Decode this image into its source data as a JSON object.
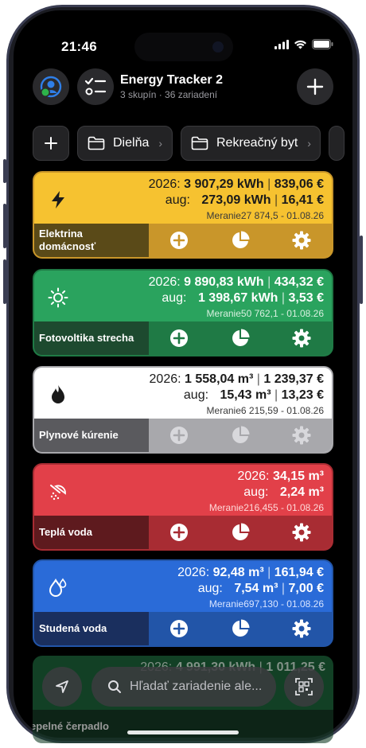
{
  "status": {
    "time": "21:46"
  },
  "header": {
    "title": "Energy Tracker 2",
    "subtitle": "3 skupín · 36 zariadení"
  },
  "groups": [
    {
      "label": "Dielňa"
    },
    {
      "label": "Rekreačný byt"
    }
  ],
  "cards": [
    {
      "name_line1": "Elektrina",
      "name_line2": "domácnosť",
      "year_label": "2026:",
      "year_amount": "3 907,29 kWh",
      "year_cost": "839,06 €",
      "month_label": "aug:",
      "month_amount": "273,09 kWh",
      "month_cost": "16,41 €",
      "meter_label": "Meranie",
      "meter_value": "27 874,5",
      "meter_date": " - 01.08.26",
      "color": "#f6c230",
      "dark": "#5a4a18",
      "bar": "#c9962a",
      "text": "#1a1a1a",
      "sub": "#3a3a3a"
    },
    {
      "name_line1": "Fotovoltika strecha",
      "name_line2": "",
      "year_label": "2026:",
      "year_amount": "9 890,83 kWh",
      "year_cost": "434,32 €",
      "month_label": "aug:",
      "month_amount": "1 398,67 kWh",
      "month_cost": "3,53 €",
      "meter_label": "Meranie",
      "meter_value": "50 762,1",
      "meter_date": " - 01.08.26",
      "color": "#2aa35e",
      "dark": "#1d4a2f",
      "bar": "#1f7a45",
      "text": "#ffffff",
      "sub": "#d8f0e0"
    },
    {
      "name_line1": "Plynové kúrenie",
      "name_line2": "",
      "year_label": "2026:",
      "year_amount": "1 558,04 m³",
      "year_cost": "1 239,37 €",
      "month_label": "aug:",
      "month_amount": "15,43 m³",
      "month_cost": "13,23 €",
      "meter_label": "Meranie",
      "meter_value": "6 215,59",
      "meter_date": " - 01.08.26",
      "color": "#ffffff",
      "dark": "#5a5a5e",
      "bar": "#a8a8ac",
      "text": "#1a1a1a",
      "sub": "#3a3a3a"
    },
    {
      "name_line1": "Teplá voda",
      "name_line2": "",
      "year_label": "2026:",
      "year_amount": "34,15 m³",
      "year_cost": "",
      "month_label": "aug:",
      "month_amount": "2,24 m³",
      "month_cost": "",
      "meter_label": "Meranie",
      "meter_value": "216,455",
      "meter_date": " - 01.08.26",
      "color": "#e24049",
      "dark": "#5e1a1e",
      "bar": "#a82c33",
      "text": "#ffffff",
      "sub": "#ffd8d8"
    },
    {
      "name_line1": "Studená voda",
      "name_line2": "",
      "year_label": "2026:",
      "year_amount": "92,48 m³",
      "year_cost": "161,94 €",
      "month_label": "aug:",
      "month_amount": "7,54 m³",
      "month_cost": "7,00 €",
      "meter_label": "Meranie",
      "meter_value": "697,130",
      "meter_date": " - 01.08.26",
      "color": "#2a6bd8",
      "dark": "#1a2f5e",
      "bar": "#2255a8",
      "text": "#ffffff",
      "sub": "#d8e4ff"
    }
  ],
  "partial_card": {
    "year_label": "2026:",
    "year_amount": "4 991,30 kWh",
    "year_cost": "1 011,25 €",
    "name": "Tepelné čerpadlo"
  },
  "bottom": {
    "search_placeholder": "Hľadať zariadenie ale..."
  }
}
